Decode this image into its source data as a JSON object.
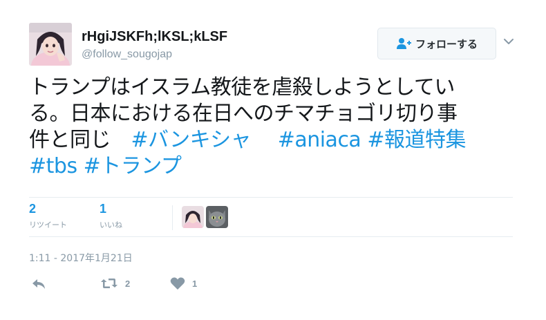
{
  "author": {
    "display_name": "rHgiJSKFh;lKSL;kLSF",
    "screen_name": "@follow_sougojap"
  },
  "follow_button": {
    "label": "フォローする"
  },
  "tweet": {
    "lines": [
      "トランプはイスラム教徒を虐殺しようとしてい",
      "る。日本における在日へのチマチョゴリ切り事",
      "件と同じ　",
      "",
      ""
    ],
    "hashtags": {
      "banki": "#バンキシャ",
      "aniaca": "#aniaca",
      "houdou": "#報道特集",
      "tbs": "#tbs",
      "trump": "#トランプ"
    }
  },
  "stats": {
    "retweets": {
      "count": "2",
      "label": "リツイート"
    },
    "likes": {
      "count": "1",
      "label": "いいね"
    }
  },
  "timestamp": "1:11 - 2017年1月21日",
  "actions": {
    "reply": {
      "icon": "reply-icon"
    },
    "retweet": {
      "icon": "retweet-icon",
      "count": "2"
    },
    "like": {
      "icon": "heart-icon",
      "count": "1"
    }
  },
  "colors": {
    "link": "#1b95e0",
    "muted": "#8899a6",
    "text": "#14171a",
    "border": "#e6ecf0"
  }
}
